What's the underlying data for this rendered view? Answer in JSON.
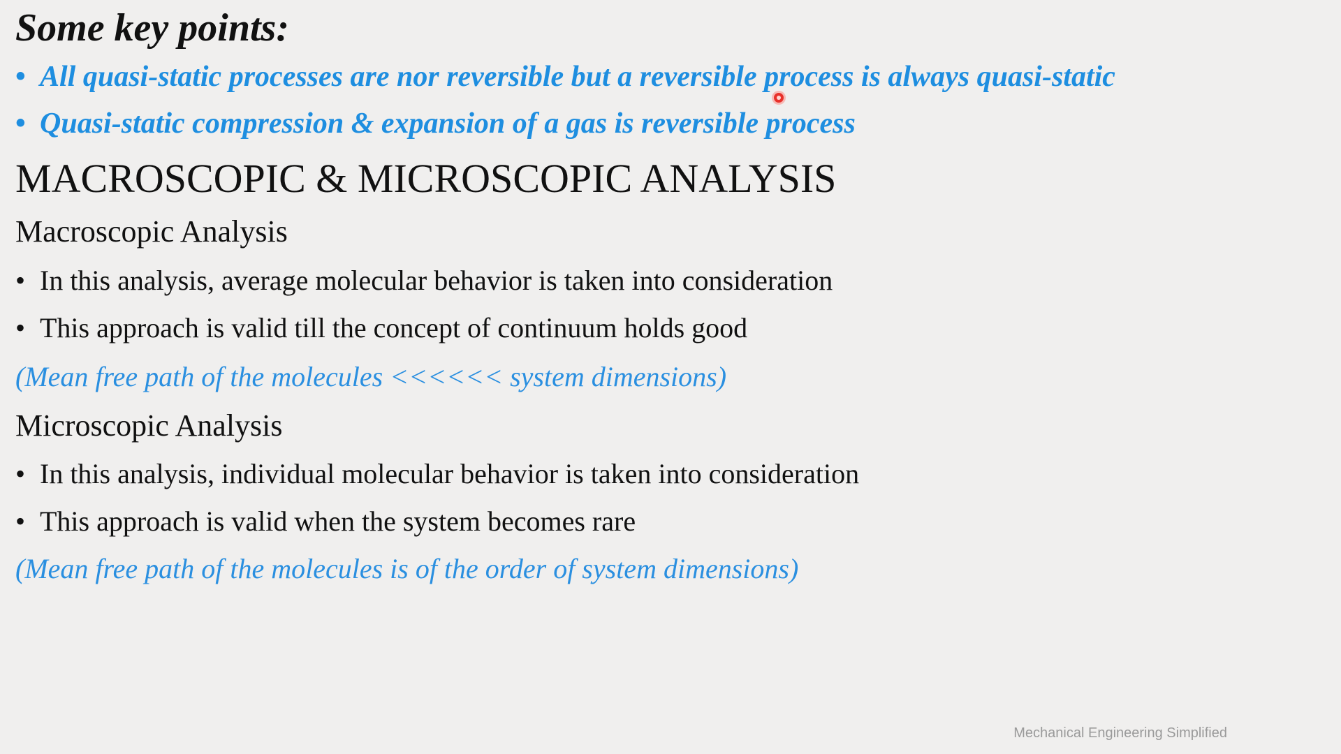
{
  "slide": {
    "keypoints_title": "Some key points:",
    "key_points": [
      "All quasi-static processes are nor reversible but a reversible process is always quasi-static",
      "Quasi-static compression & expansion of a gas is reversible process"
    ],
    "bullet_symbol": "•",
    "main_heading": "MACROSCOPIC & MICROSCOPIC ANALYSIS",
    "macroscopic": {
      "heading": "Macroscopic Analysis",
      "points": [
        "In this analysis, average molecular behavior is taken into consideration",
        "This approach is valid till the concept of continuum holds good"
      ],
      "note": "(Mean free path of the molecules <<<<<< system dimensions)"
    },
    "microscopic": {
      "heading": "Microscopic Analysis",
      "points": [
        "In this analysis, individual molecular behavior is taken into consideration",
        "This approach is valid when the system becomes rare"
      ],
      "note": "(Mean free path of the molecules is of the order of system dimensions)"
    },
    "watermark": "Mechanical Engineering Simplified"
  },
  "colors": {
    "background": "#f0efee",
    "accent_blue": "#1e8ee0",
    "text": "#111111",
    "pointer": "#e8312b",
    "watermark": "#9a9a9a"
  }
}
